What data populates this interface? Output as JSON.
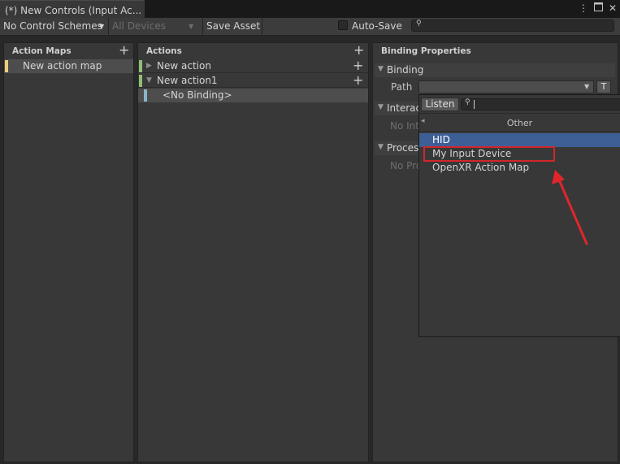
{
  "window": {
    "tab_title": "(*) New Controls (Input Ac...",
    "icons": [
      "kebab-menu-icon",
      "maximize-icon",
      "close-icon"
    ]
  },
  "toolbar": {
    "control_schemes": "No Control Schemes",
    "devices": "All Devices",
    "save_asset": "Save Asset",
    "auto_save_label": "Auto-Save",
    "auto_save_checked": false,
    "search_value": ""
  },
  "action_maps": {
    "header": "Action Maps",
    "items": [
      {
        "label": "New action map",
        "color": "#e9cf7a",
        "selected": true
      }
    ]
  },
  "actions": {
    "header": "Actions",
    "items": [
      {
        "label": "New action",
        "expanded": false,
        "color": "#8fbf75"
      },
      {
        "label": "New action1",
        "expanded": true,
        "color": "#8fbf75"
      }
    ],
    "bindings": [
      {
        "label": "<No Binding>",
        "color": "#8ab4c7",
        "selected": true
      }
    ]
  },
  "binding_properties": {
    "header": "Binding Properties",
    "binding_section": "Binding",
    "path_label": "Path",
    "path_value": "",
    "t_button": "T",
    "interactions_section": "Interac",
    "interactions_empty": "No Inte",
    "processors_section": "Proces",
    "processors_empty": "No Pro"
  },
  "popup": {
    "listen_label": "Listen",
    "search_value": "",
    "back_arrow": "◂",
    "category": "Other",
    "items": [
      {
        "label": "HID",
        "selected": true
      },
      {
        "label": "My Input Device",
        "highlighted": true
      },
      {
        "label": "OpenXR Action Map"
      }
    ]
  },
  "colors": {
    "selection": "#3e5f96",
    "highlight_box": "#d1262a",
    "arrow": "#e0262a"
  }
}
